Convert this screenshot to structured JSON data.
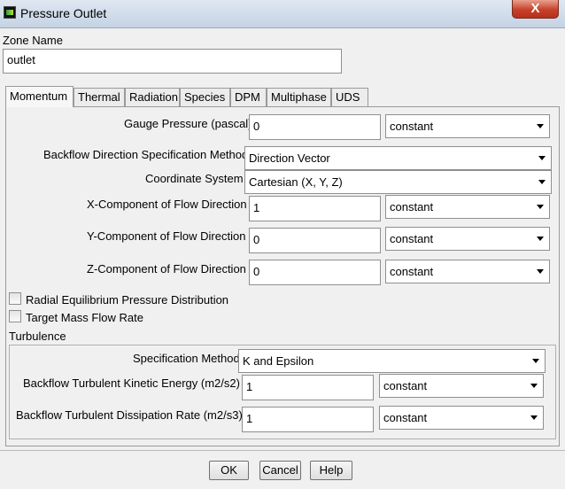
{
  "window": {
    "title": "Pressure Outlet",
    "close_label": "X"
  },
  "zone": {
    "label": "Zone Name",
    "value": "outlet"
  },
  "tabs": [
    {
      "label": "Momentum"
    },
    {
      "label": "Thermal"
    },
    {
      "label": "Radiation"
    },
    {
      "label": "Species"
    },
    {
      "label": "DPM"
    },
    {
      "label": "Multiphase"
    },
    {
      "label": "UDS"
    }
  ],
  "momentum": {
    "gauge_pressure": {
      "label": "Gauge Pressure (pascal)",
      "value": "0",
      "method": "constant"
    },
    "backflow_direction": {
      "label": "Backflow Direction Specification Method",
      "value": "Direction Vector"
    },
    "coordinate_system": {
      "label": "Coordinate System",
      "value": "Cartesian (X, Y, Z)"
    },
    "x_component": {
      "label": "X-Component of Flow Direction",
      "value": "1",
      "method": "constant"
    },
    "y_component": {
      "label": "Y-Component of Flow Direction",
      "value": "0",
      "method": "constant"
    },
    "z_component": {
      "label": "Z-Component of Flow Direction",
      "value": "0",
      "method": "constant"
    },
    "radial_equilibrium": {
      "label": "Radial Equilibrium Pressure Distribution",
      "checked": false
    },
    "target_mass_flow": {
      "label": "Target Mass Flow Rate",
      "checked": false
    }
  },
  "turbulence": {
    "title": "Turbulence",
    "specification_method": {
      "label": "Specification Method",
      "value": "K and Epsilon"
    },
    "kinetic_energy": {
      "label": "Backflow Turbulent Kinetic Energy (m2/s2)",
      "value": "1",
      "method": "constant"
    },
    "dissipation_rate": {
      "label": "Backflow Turbulent Dissipation Rate (m2/s3)",
      "value": "1",
      "method": "constant"
    }
  },
  "buttons": {
    "ok": "OK",
    "cancel": "Cancel",
    "help": "Help"
  }
}
